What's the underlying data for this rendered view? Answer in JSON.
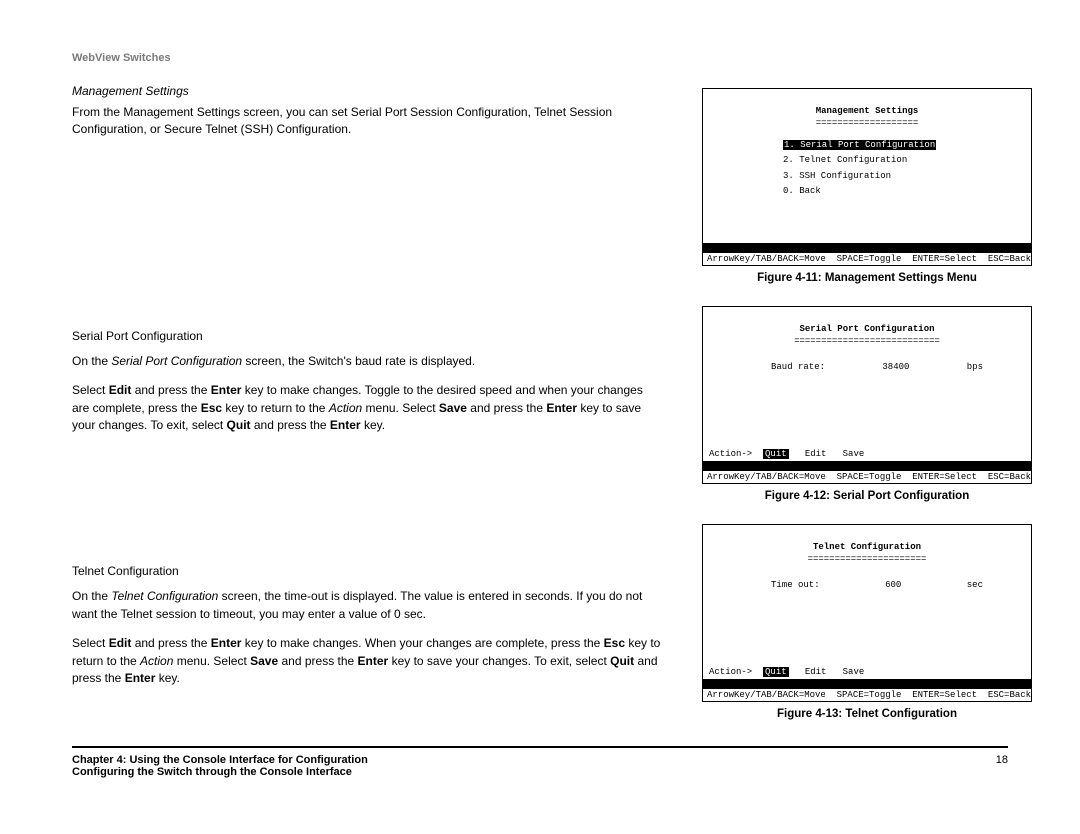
{
  "header": "WebView Switches",
  "sec1": {
    "title": "Management Settings",
    "p1": "From the Management Settings screen, you can set Serial Port Session Configuration, Telnet Session Configuration, or Secure Telnet (SSH) Configuration."
  },
  "sec2": {
    "title": "Serial Port Configuration",
    "p1a": "On the ",
    "p1i": "Serial Port Configuration",
    "p1b": " screen, the Switch's baud rate is displayed.",
    "p2a": "Select ",
    "p2b": " and press the ",
    "p2c": " key to make changes. Toggle to the desired speed and when your changes are complete, press the ",
    "p2d": " key to return to the ",
    "p2e": " menu. Select ",
    "p2f": " and press the ",
    "p2g": " key to save your changes. To exit, select ",
    "p2h": " and press the ",
    "p2i": " key.",
    "kw": {
      "edit": "Edit",
      "enter": "Enter",
      "esc": "Esc",
      "action": "Action",
      "save": "Save",
      "quit": "Quit"
    }
  },
  "sec3": {
    "title": "Telnet Configuration",
    "p1a": "On the ",
    "p1i": "Telnet Configuration",
    "p1b": " screen, the time-out is displayed. The value is entered in seconds. If you do not want the Telnet session to timeout, you may enter a value of 0 sec.",
    "p2a": "Select ",
    "p2b": " and press the ",
    "p2c": " key to make changes. When your changes are complete, press the ",
    "p2d": " key to return to the ",
    "p2e": " menu. Select ",
    "p2f": " and press the ",
    "p2g": " key to save your changes. To exit, select ",
    "p2h": " and press the ",
    "p2i": " key.",
    "kw": {
      "edit": "Edit",
      "enter": "Enter",
      "esc": "Esc",
      "action": "Action",
      "save": "Save",
      "quit": "Quit"
    }
  },
  "fig1": {
    "title": "Management Settings",
    "under": "===================",
    "item1": "1. Serial Port Configuration",
    "item2": "2. Telnet Configuration",
    "item3": "3. SSH Configuration",
    "item0": "0. Back",
    "hints": "ArrowKey/TAB/BACK=Move  SPACE=Toggle  ENTER=Select  ESC=Back",
    "caption": "Figure 4-11: Management Settings Menu"
  },
  "fig2": {
    "title": "Serial Port Configuration",
    "under": "===========================",
    "label": "Baud rate:",
    "value": "38400",
    "unit": "bps",
    "action": "Action->",
    "quit": "Quit",
    "edit": "Edit",
    "save": "Save",
    "hints": "ArrowKey/TAB/BACK=Move  SPACE=Toggle  ENTER=Select  ESC=Back",
    "caption": "Figure 4-12: Serial Port Configuration"
  },
  "fig3": {
    "title": "Telnet Configuration",
    "under": "======================",
    "label": "Time out:",
    "value": "600",
    "unit": "sec",
    "action": "Action->",
    "quit": "Quit",
    "edit": "Edit",
    "save": "Save",
    "hints": "ArrowKey/TAB/BACK=Move  SPACE=Toggle  ENTER=Select  ESC=Back",
    "caption": "Figure 4-13: Telnet Configuration"
  },
  "footer": {
    "line1": "Chapter 4: Using the Console Interface for Configuration",
    "line2": "Configuring the Switch through the Console Interface",
    "page": "18"
  }
}
